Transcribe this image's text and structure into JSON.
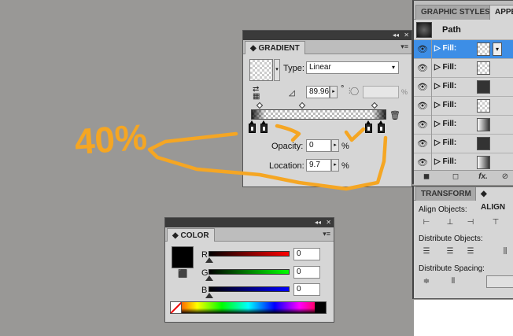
{
  "gradient_panel": {
    "title": "GRADIENT",
    "type_label": "Type:",
    "type_value": "Linear",
    "angle_value": "89.96",
    "aspect_unit": "%",
    "degree_symbol": "°",
    "opacity_label": "Opacity:",
    "opacity_value": "0",
    "location_label": "Location:",
    "location_value": "9.7",
    "percent": "%"
  },
  "color_panel": {
    "title": "COLOR",
    "r_label": "R",
    "g_label": "G",
    "b_label": "B",
    "r_value": "0",
    "g_value": "0",
    "b_value": "0"
  },
  "appearance_panel": {
    "tab_graphic_styles": "GRAPHIC STYLES",
    "tab_appearance": "APPE",
    "object_label": "Path",
    "rows": [
      {
        "label": "Fill:",
        "swatch": "checker",
        "selected": true
      },
      {
        "label": "Fill:",
        "swatch": "checker",
        "selected": false
      },
      {
        "label": "Fill:",
        "swatch": "dark",
        "selected": false
      },
      {
        "label": "Fill:",
        "swatch": "checker",
        "selected": false
      },
      {
        "label": "Fill:",
        "swatch": "gradient",
        "selected": false
      },
      {
        "label": "Fill:",
        "swatch": "dark",
        "selected": false
      },
      {
        "label": "Fill:",
        "swatch": "gradient",
        "selected": false
      }
    ]
  },
  "align_panel": {
    "tab_transform": "TRANSFORM",
    "tab_align": "ALIGN",
    "align_objects": "Align Objects:",
    "distribute_objects": "Distribute Objects:",
    "distribute_spacing": "Distribute Spacing:"
  },
  "annotation": {
    "text": "40%",
    "color": "#f5a623"
  },
  "colors": {
    "canvas": "#999896",
    "panel": "#d6d6d6",
    "selection": "#3d8ee6"
  }
}
